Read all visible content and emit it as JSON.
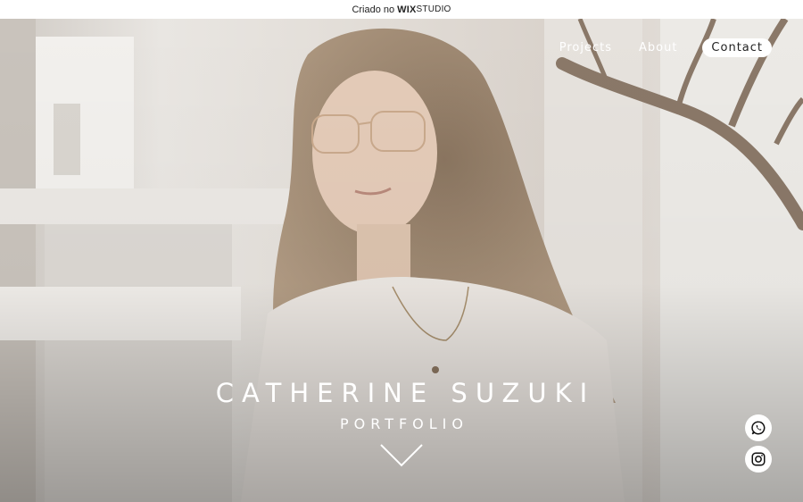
{
  "topbar": {
    "prefix": "Criado no",
    "brand": "WIX",
    "brand_suffix": "STUDIO"
  },
  "nav": {
    "items": [
      "Projects",
      "About"
    ],
    "contact": "Contact"
  },
  "hero": {
    "name": "CATHERINE SUZUKI",
    "subtitle": "PORTFOLIO"
  },
  "social": [
    "whatsapp-icon",
    "instagram-icon"
  ]
}
